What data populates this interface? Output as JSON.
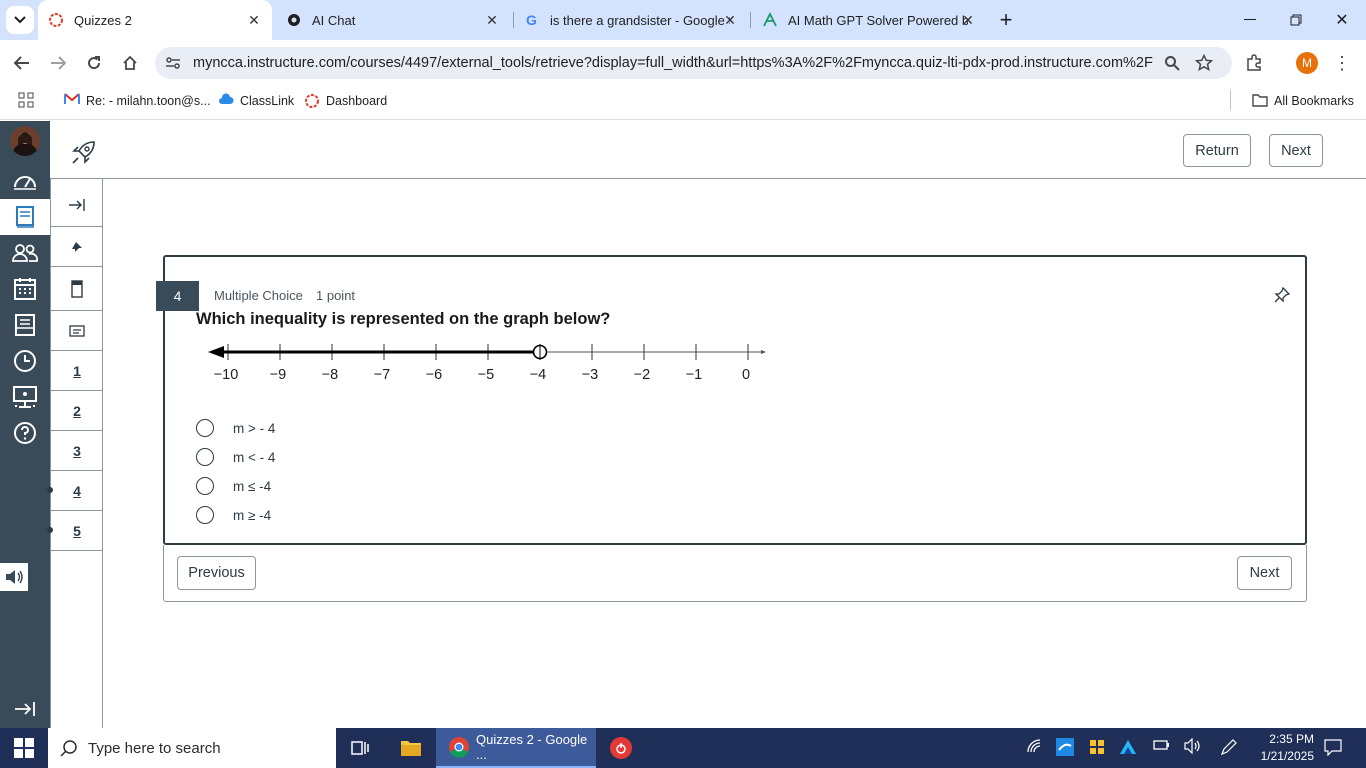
{
  "browser": {
    "tabs": [
      {
        "title": "Quizzes 2",
        "active": true
      },
      {
        "title": "AI Chat",
        "active": false
      },
      {
        "title": "is there a grandsister - Google S",
        "active": false
      },
      {
        "title": "AI Math GPT Solver Powered by",
        "active": false
      }
    ],
    "url": "myncca.instructure.com/courses/4497/external_tools/retrieve?display=full_width&url=https%3A%2F%2Fmyncca.quiz-lti-pdx-prod.instructure.com%2Flti%...",
    "profile_initial": "M",
    "bookmarks": [
      {
        "label": "Re: - milahn.toon@s..."
      },
      {
        "label": "ClassLink"
      },
      {
        "label": "Dashboard"
      }
    ],
    "all_bookmarks": "All Bookmarks"
  },
  "quiz": {
    "return_label": "Return",
    "next_label_top": "Next",
    "sidebar_numbers": [
      "1",
      "2",
      "3",
      "4",
      "5"
    ],
    "question_number": "4",
    "question_type": "Multiple Choice",
    "points": "1 point",
    "question_text": "Which inequality is represented on the graph below?",
    "number_line": {
      "tick_labels": [
        "−10",
        "−9",
        "−8",
        "−7",
        "−6",
        "−5",
        "−4",
        "−3",
        "−2",
        "−1",
        "0"
      ],
      "open_circle_at": -4,
      "shaded_direction": "left"
    },
    "options": [
      {
        "label": "m > - 4"
      },
      {
        "label": "m < - 4"
      },
      {
        "label": "m ≤ -4"
      },
      {
        "label": "m ≥ -4"
      }
    ],
    "previous_label": "Previous",
    "next_label_bottom": "Next"
  },
  "taskbar": {
    "search_placeholder": "Type here to search",
    "chrome_task": "Quizzes 2 - Google ...",
    "time": "2:35 PM",
    "date": "1/21/2025"
  }
}
